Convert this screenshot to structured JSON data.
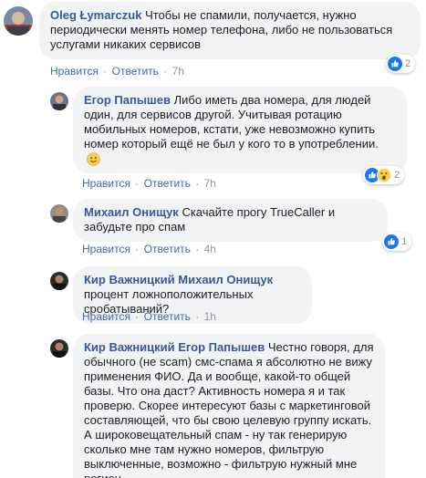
{
  "colors": {
    "link": "#385898",
    "action": "#4267b2",
    "meta": "#90949c",
    "bubble": "#f2f3f5",
    "like": "#1877f2"
  },
  "comments": [
    {
      "author": "Oleg Łymarczuk",
      "text": "Чтобы не спамили, получается, нужно периодически менять номер телефона, либо не пользоваться услугами никаких сервисов",
      "like": "Нравится",
      "reply": "Ответить",
      "time": "7h",
      "reactions": {
        "icons": [
          "like-icon"
        ],
        "count": "2"
      }
    },
    {
      "author": "Егор Папышев",
      "text": "Либо иметь два номера, для людей один, для сервисов другой. Учитывая ротацию мобильных номеров, кстати, уже невозможно купить номер который ещё не был у кого то в употреблении.",
      "emoji": "smile-emoji",
      "like": "Нравится",
      "reply": "Ответить",
      "time": "7h",
      "reactions": {
        "icons": [
          "like-icon",
          "wow-icon"
        ],
        "count": "2"
      }
    },
    {
      "author": "Михаил Онищук",
      "text": "Скачайте прогу TrueCaller и забудьте про спам",
      "like": "Нравится",
      "reply": "Ответить",
      "time": "4h",
      "reactions": {
        "icons": [
          "like-icon"
        ],
        "count": "1"
      }
    },
    {
      "author": "Кир Важницкий",
      "mention": "Михаил Онищук",
      "text": "процент ложноположительных сробатываний?",
      "like": "Нравится",
      "reply": "Ответить",
      "time": "1h"
    },
    {
      "author": "Кир Важницкий",
      "mention": "Егор Папышев",
      "text": "Честно говоря, для обычного (не scam) смс-спама я абсолютно не вижу применения ФИО. Да и вообще, какой-то общей базы. Что она даст? Активность номера я и так проверю. Скорее интересуют базы с маркетинговой составляющей, что бы свою целевую группу искать. А широковещательный спам - ну так генерирую сколько мне там нужно номеров, фильтрую выключенные, возможно - фильтрую нужный мне регион."
    }
  ]
}
